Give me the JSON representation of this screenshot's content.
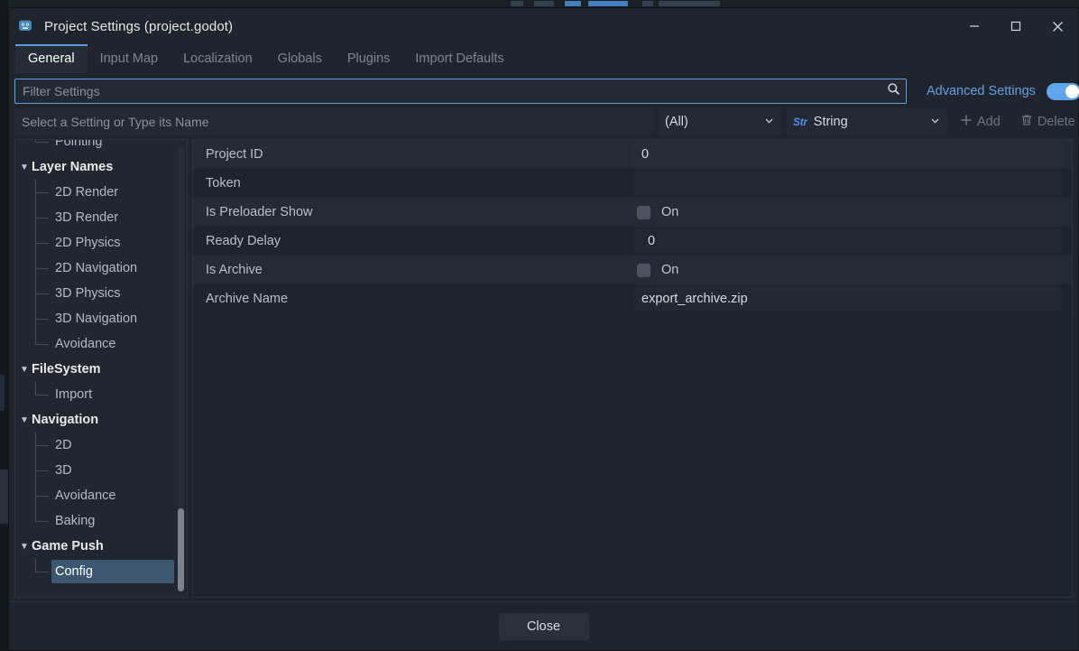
{
  "window": {
    "title": "Project Settings (project.godot)",
    "icon": "godot-logo-icon",
    "controls": {
      "minimize": "minimize-icon",
      "maximize": "maximize-icon",
      "close": "close-icon"
    }
  },
  "tabs": [
    {
      "label": "General",
      "active": true
    },
    {
      "label": "Input Map",
      "active": false
    },
    {
      "label": "Localization",
      "active": false
    },
    {
      "label": "Globals",
      "active": false
    },
    {
      "label": "Plugins",
      "active": false
    },
    {
      "label": "Import Defaults",
      "active": false
    }
  ],
  "toolbar": {
    "filter_value": "",
    "filter_placeholder": "Filter Settings",
    "search_icon": "search-icon",
    "advanced_settings_label": "Advanced Settings",
    "advanced_settings_enabled": true,
    "accent_color": "#5aa0e6"
  },
  "add_setting": {
    "name_value": "",
    "name_placeholder": "Select a Setting or Type its Name",
    "scope_selected": "(All)",
    "type_selected": "String",
    "type_icon_text": "Str",
    "add_label": "Add",
    "delete_label": "Delete",
    "add_enabled": false,
    "delete_enabled": false
  },
  "sidebar": {
    "items": [
      {
        "label": "Pointing",
        "type": "child",
        "last": true,
        "selected": false,
        "cut_off_top": true
      },
      {
        "label": "Layer Names",
        "type": "category",
        "selected": false
      },
      {
        "label": "2D Render",
        "type": "child",
        "selected": false
      },
      {
        "label": "3D Render",
        "type": "child",
        "selected": false
      },
      {
        "label": "2D Physics",
        "type": "child",
        "selected": false
      },
      {
        "label": "2D Navigation",
        "type": "child",
        "selected": false
      },
      {
        "label": "3D Physics",
        "type": "child",
        "selected": false
      },
      {
        "label": "3D Navigation",
        "type": "child",
        "selected": false
      },
      {
        "label": "Avoidance",
        "type": "child",
        "last": true,
        "selected": false
      },
      {
        "label": "FileSystem",
        "type": "category",
        "selected": false
      },
      {
        "label": "Import",
        "type": "child",
        "last": true,
        "selected": false
      },
      {
        "label": "Navigation",
        "type": "category",
        "selected": false
      },
      {
        "label": "2D",
        "type": "child",
        "selected": false
      },
      {
        "label": "3D",
        "type": "child",
        "selected": false
      },
      {
        "label": "Avoidance",
        "type": "child",
        "selected": false
      },
      {
        "label": "Baking",
        "type": "child",
        "last": true,
        "selected": false
      },
      {
        "label": "Game Push",
        "type": "category",
        "selected": false
      },
      {
        "label": "Config",
        "type": "child",
        "last": true,
        "selected": true
      }
    ],
    "selection_color": "#3e5771"
  },
  "settings": {
    "rows": [
      {
        "key": "Project ID",
        "kind": "text",
        "value": "0"
      },
      {
        "key": "Token",
        "kind": "text",
        "value": ""
      },
      {
        "key": "Is Preloader Show",
        "kind": "checkbox",
        "value": "On",
        "checked": false
      },
      {
        "key": "Ready Delay",
        "kind": "number",
        "value": "0"
      },
      {
        "key": "Is Archive",
        "kind": "checkbox",
        "value": "On",
        "checked": false
      },
      {
        "key": "Archive Name",
        "kind": "text",
        "value": "export_archive.zip"
      }
    ]
  },
  "footer": {
    "close_label": "Close"
  }
}
